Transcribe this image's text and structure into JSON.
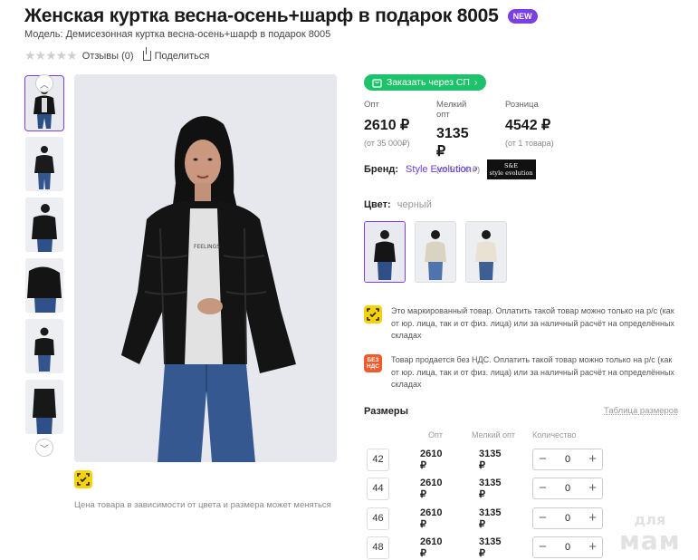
{
  "product": {
    "title": "Женская куртка весна-осень+шарф в подарок 8005",
    "badge": "NEW",
    "model": "Модель: Демисезонная куртка весна-осень+шарф в подарок 8005",
    "reviews": "Отзывы (0)",
    "share": "Поделиться",
    "rating": 0
  },
  "gallery": {
    "thumbnail_count": 6,
    "active_index": 0,
    "price_note": "Цена товара в зависимости от цвета и размера может меняться",
    "shirt_text": "FEELINGS"
  },
  "sp_button": "Заказать через СП",
  "prices": [
    {
      "label": "Опт",
      "value": "2610 ₽",
      "min": "(от 35 000₽)"
    },
    {
      "label": "Мелкий опт",
      "value": "3135 ₽",
      "min": "(от 5 000 ₽)"
    },
    {
      "label": "Розница",
      "value": "4542 ₽",
      "min": "(от 1 товара)"
    }
  ],
  "brand": {
    "label": "Бренд:",
    "name": "Style Evolution",
    "logo_mark": "S&E",
    "logo_text": "style evolution"
  },
  "color": {
    "label": "Цвет:",
    "value": "черный"
  },
  "notices": [
    {
      "icon": "marking-icon",
      "text": "Это маркированный товар. Оплатить такой товар можно только на р/с (как от юр. лица, так и от физ. лица) или за наличный расчёт на определённых складах"
    },
    {
      "icon": "no-vat-icon",
      "badge": "БЕЗ НДС",
      "text": "Товар продается без НДС. Оплатить такой товар можно только на р/с (как от юр. лица, так и от физ. лица) или за наличный расчёт на определённых складах"
    }
  ],
  "sizes": {
    "title": "Размеры",
    "table_link": "Таблица размеров",
    "headers": [
      "Опт",
      "Мелкий опт",
      "Количество"
    ],
    "rows": [
      {
        "size": "42",
        "opt": "2610 ₽",
        "small": "3135 ₽",
        "qty": "0"
      },
      {
        "size": "44",
        "opt": "2610 ₽",
        "small": "3135 ₽",
        "qty": "0"
      },
      {
        "size": "46",
        "opt": "2610 ₽",
        "small": "3135 ₽",
        "qty": "0"
      },
      {
        "size": "48",
        "opt": "2610 ₽",
        "small": "3135 ₽",
        "qty": "0"
      }
    ]
  },
  "watermark": [
    "для",
    "мам"
  ],
  "colors": {
    "accent": "#7b3fe4",
    "sp_green": "#1ec26b",
    "marking_yellow": "#f5d20a",
    "nds_orange": "#ef5b2c"
  }
}
